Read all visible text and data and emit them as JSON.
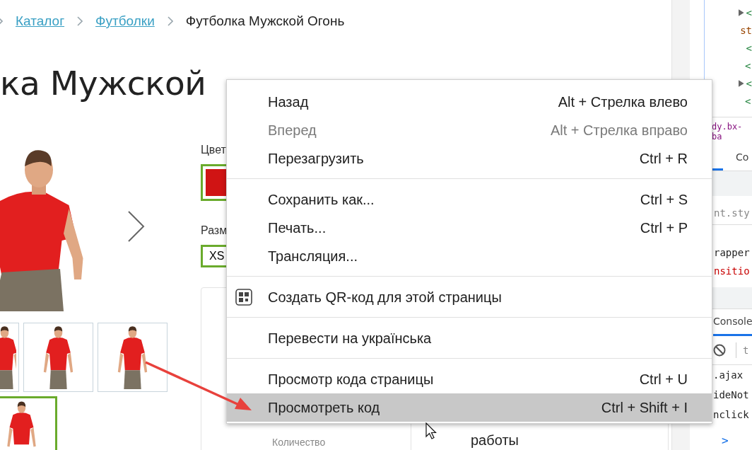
{
  "breadcrumb": [
    {
      "label": "Каталог",
      "kind": "link"
    },
    {
      "label": "Футболки",
      "kind": "link"
    },
    {
      "label": "Футболка Мужской Огонь",
      "kind": "current"
    }
  ],
  "heading": "ка Мужской",
  "gallery": {
    "thumbnails": [
      {
        "selected": false
      },
      {
        "selected": false
      },
      {
        "selected": false
      },
      {
        "selected": true
      }
    ]
  },
  "options": {
    "color_label": "Цвет",
    "color_swatch": {
      "color": "#d01414",
      "selected": true
    },
    "size_label": "Разм",
    "size": {
      "value": "XS",
      "selected": true
    }
  },
  "panel": {
    "quantity_label": "Количество",
    "description": "работы"
  },
  "context_menu": {
    "groups": [
      {
        "items": [
          {
            "kind": "command",
            "label": "Назад",
            "shortcut": "Alt + Стрелка влево",
            "disabled": false,
            "selected": false
          },
          {
            "kind": "command",
            "label": "Вперед",
            "shortcut": "Alt + Стрелка вправо",
            "disabled": true,
            "selected": false
          },
          {
            "kind": "command",
            "label": "Перезагрузить",
            "shortcut": "Ctrl + R",
            "disabled": false,
            "selected": false
          }
        ]
      },
      {
        "items": [
          {
            "kind": "command",
            "label": "Сохранить как...",
            "shortcut": "Ctrl + S",
            "disabled": false,
            "selected": false
          },
          {
            "kind": "command",
            "label": "Печать...",
            "shortcut": "Ctrl + P",
            "disabled": false,
            "selected": false
          },
          {
            "kind": "command",
            "label": "Трансляция...",
            "disabled": false,
            "selected": false
          }
        ]
      },
      {
        "items": [
          {
            "kind": "qr",
            "label": "Создать QR-код для этой страницы",
            "disabled": false,
            "selected": false
          }
        ]
      },
      {
        "items": [
          {
            "kind": "command",
            "label": "Перевести на українська",
            "disabled": false,
            "selected": false
          }
        ]
      },
      {
        "items": [
          {
            "kind": "command",
            "label": "Просмотр кода страницы",
            "shortcut": "Ctrl + U",
            "disabled": false,
            "selected": false
          },
          {
            "kind": "command",
            "label": "Просмотреть код",
            "shortcut": "Ctrl + Shift + I",
            "disabled": false,
            "selected": true
          }
        ]
      }
    ]
  },
  "devtools": {
    "tree": [
      {
        "kind": "tag",
        "text": "<",
        "collapsed": true
      },
      {
        "kind": "attr",
        "text": "st",
        "collapsed": false
      },
      {
        "kind": "tag",
        "text": "<",
        "collapsed": false
      },
      {
        "kind": "tag",
        "text": "<",
        "collapsed": false
      },
      {
        "kind": "tag",
        "text": "<",
        "collapsed": true
      },
      {
        "kind": "tag",
        "text": "<",
        "collapsed": false
      }
    ],
    "crumb": "dy.bx-ba",
    "tabs": [
      {
        "label": "Co",
        "selected": false
      }
    ],
    "styles": [
      {
        "kind": "selector",
        "text": "nt.sty"
      },
      {
        "kind": "selector",
        "text": "rapper"
      },
      {
        "kind": "property",
        "text": "nsitio"
      }
    ],
    "console_tab": {
      "label": "Console",
      "selected": true
    },
    "console_filter": "t",
    "console_lines": [
      ".ajax",
      "ideNot",
      "nclick"
    ],
    "prompt": ">"
  }
}
